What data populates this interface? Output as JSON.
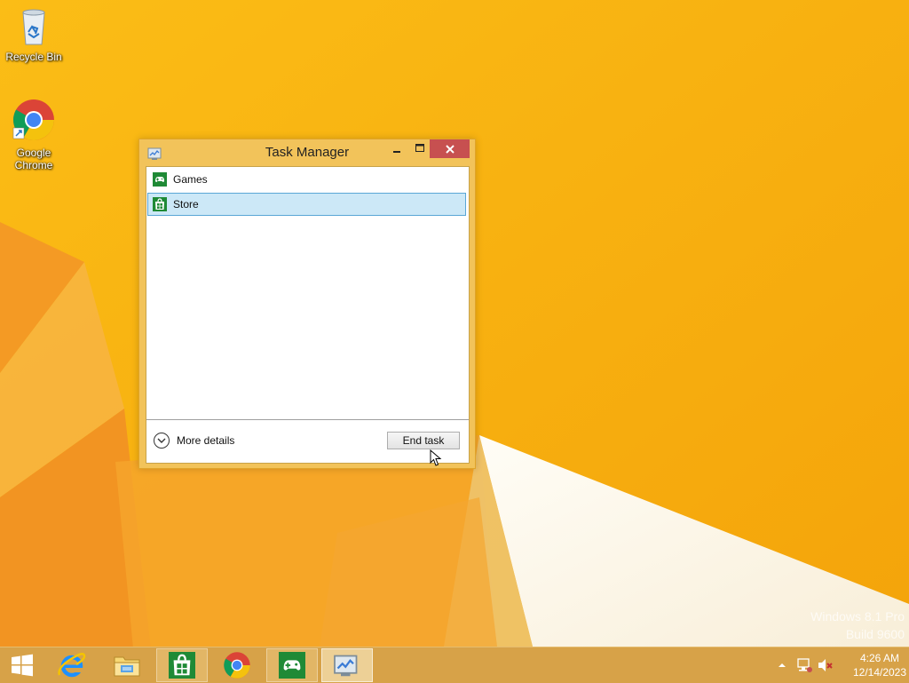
{
  "desktop": {
    "icons": [
      {
        "label": "Recycle Bin",
        "icon": "recycle-bin-icon"
      },
      {
        "label": "Google Chrome",
        "icon": "chrome-icon"
      }
    ]
  },
  "task_manager": {
    "title": "Task Manager",
    "processes": [
      {
        "name": "Games",
        "icon": "games-icon",
        "selected": false
      },
      {
        "name": "Store",
        "icon": "store-icon",
        "selected": true
      }
    ],
    "more_details_label": "More details",
    "end_task_label": "End task"
  },
  "watermark": {
    "line1": "Windows 8.1 Pro",
    "line2": "Build 9600"
  },
  "taskbar": {
    "items": [
      {
        "name": "start",
        "icon": "windows-start-icon"
      },
      {
        "name": "internet-explorer",
        "icon": "internet-explorer-icon"
      },
      {
        "name": "file-explorer",
        "icon": "file-explorer-icon"
      },
      {
        "name": "store",
        "icon": "store-icon",
        "state": "running"
      },
      {
        "name": "chrome",
        "icon": "chrome-icon"
      },
      {
        "name": "games",
        "icon": "games-icon",
        "state": "running"
      },
      {
        "name": "task-manager",
        "icon": "task-manager-icon",
        "state": "active"
      }
    ],
    "clock": {
      "time": "4:26 AM",
      "date": "12/14/2023"
    }
  },
  "colors": {
    "wallpaper": "#f7ae0c",
    "window_frame": "#f2c35a",
    "close_button": "#c75050",
    "selection": "#cce8f7",
    "taskbar": "#d7a248"
  }
}
